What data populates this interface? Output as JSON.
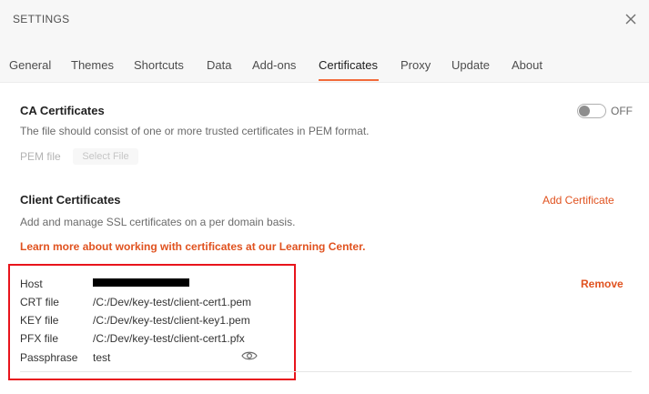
{
  "window": {
    "title": "SETTINGS",
    "close_icon": "close-icon"
  },
  "tabs": [
    {
      "label": "General"
    },
    {
      "label": "Themes"
    },
    {
      "label": "Shortcuts"
    },
    {
      "label": "Data"
    },
    {
      "label": "Add-ons"
    },
    {
      "label": "Certificates",
      "active": true
    },
    {
      "label": "Proxy"
    },
    {
      "label": "Update"
    },
    {
      "label": "About"
    }
  ],
  "ca": {
    "title": "CA Certificates",
    "description": "The file should consist of one or more trusted certificates in PEM format.",
    "pem_label": "PEM file",
    "select_file": "Select File",
    "toggle_state": "OFF"
  },
  "client": {
    "title": "Client Certificates",
    "add_label": "Add Certificate",
    "description": "Add and manage SSL certificates on a per domain basis.",
    "learn_more": "Learn more about working with certificates at our Learning Center."
  },
  "certificate": {
    "host_label": "Host",
    "crt_label": "CRT file",
    "crt_value": "/C:/Dev/key-test/client-cert1.pem",
    "key_label": "KEY file",
    "key_value": "/C:/Dev/key-test/client-key1.pem",
    "pfx_label": "PFX file",
    "pfx_value": "/C:/Dev/key-test/client-cert1.pfx",
    "pass_label": "Passphrase",
    "pass_value": "test",
    "remove_label": "Remove",
    "eye_icon": "eye-icon"
  },
  "colors": {
    "accent": "#e0521f",
    "tab_underline": "#f26b3a",
    "highlight": "#e8141c"
  }
}
